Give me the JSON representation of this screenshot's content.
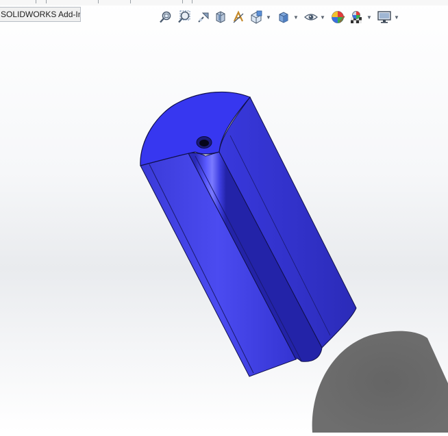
{
  "app": {
    "addins_tab_label": "SOLIDWORKS Add-Ins"
  },
  "heads_up_toolbar": {
    "icons": [
      "zoom-to-fit-icon",
      "zoom-to-area-icon",
      "previous-view-icon",
      "section-view-icon",
      "dynamic-annotation-views-icon",
      "view-orientation-icon",
      "display-style-icon",
      "hide-show-items-icon",
      "edit-appearance-icon",
      "apply-scene-icon",
      "view-settings-icon"
    ]
  },
  "model": {
    "color": "#3b3bf0",
    "shadow_color": "#6b6b6b",
    "background_colors": [
      "#ffffff",
      "#e9ebee"
    ]
  }
}
